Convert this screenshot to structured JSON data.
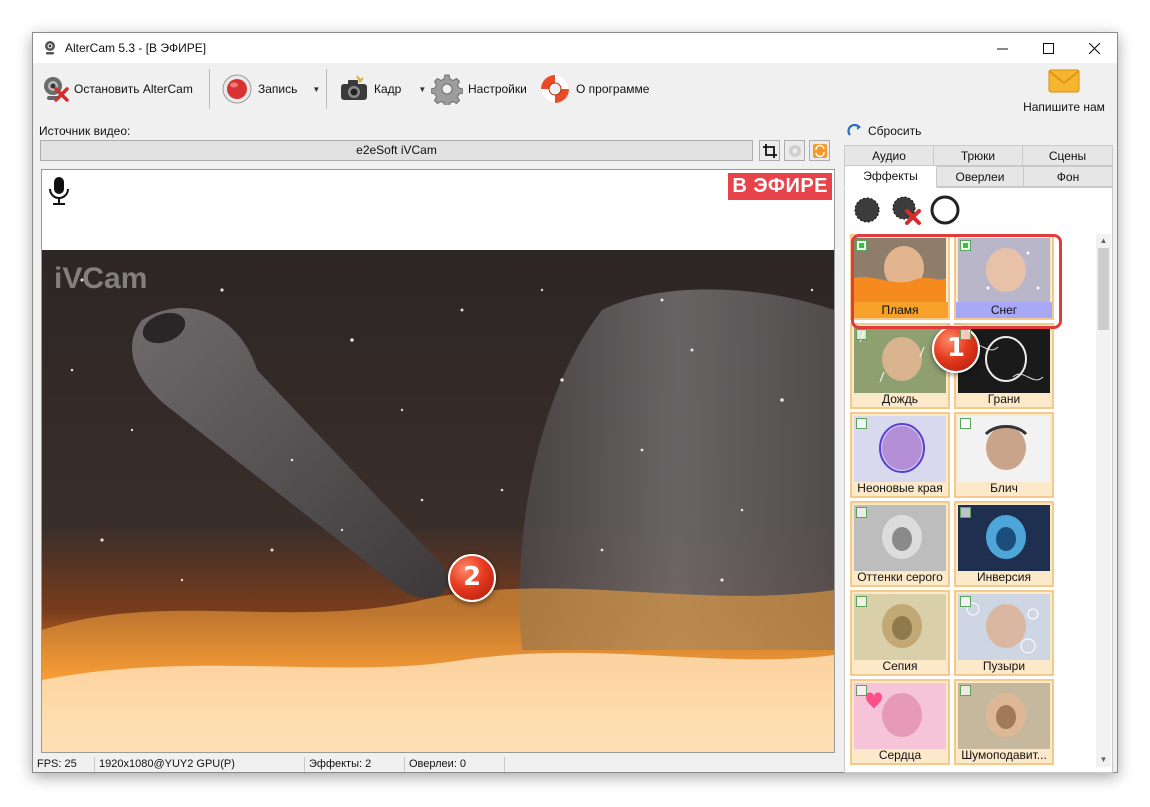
{
  "window": {
    "title": "AlterCam 5.3 - [В ЭФИРЕ]"
  },
  "toolbar": {
    "stop_label": "Остановить AlterCam",
    "record_label": "Запись",
    "frame_label": "Кадр",
    "settings_label": "Настройки",
    "about_label": "О программе",
    "contact_label": "Напишите нам"
  },
  "source": {
    "label": "Источник видео:",
    "device": "e2eSoft iVCam"
  },
  "preview": {
    "on_air_label": "В ЭФИРЕ",
    "watermark": "iVCam",
    "marker_2": "2"
  },
  "statusbar": {
    "fps": "FPS: 25",
    "resolution": "1920x1080@YUY2 GPU(P)",
    "effects": "Эффекты: 2",
    "overlays": "Оверлеи: 0"
  },
  "panel": {
    "reset_label": "Сбросить",
    "tabs_row1": [
      "Аудио",
      "Трюки",
      "Сцены"
    ],
    "tabs_row2": [
      "Эффекты",
      "Оверлеи",
      "Фон"
    ],
    "active_tab": "Эффекты",
    "marker_1": "1",
    "effects": [
      {
        "name": "Пламя",
        "checked": true,
        "selected": true
      },
      {
        "name": "Снег",
        "checked": true,
        "selected": true
      },
      {
        "name": "Дождь",
        "checked": false
      },
      {
        "name": "Грани",
        "checked": false
      },
      {
        "name": "Неоновые края",
        "checked": false
      },
      {
        "name": "Блич",
        "checked": false
      },
      {
        "name": "Оттенки серого",
        "checked": false
      },
      {
        "name": "Инверсия",
        "checked": false
      },
      {
        "name": "Сепия",
        "checked": false
      },
      {
        "name": "Пузыри",
        "checked": false
      },
      {
        "name": "Сердца",
        "checked": false
      },
      {
        "name": "Шумоподавит...",
        "checked": false
      }
    ]
  },
  "colors": {
    "on_air": "#e8424a",
    "selection_ring": "#e13c3c",
    "flame_label": "#f7a12a",
    "snow_label": "#a7a8f6",
    "tile_border": "#f4c98c"
  }
}
